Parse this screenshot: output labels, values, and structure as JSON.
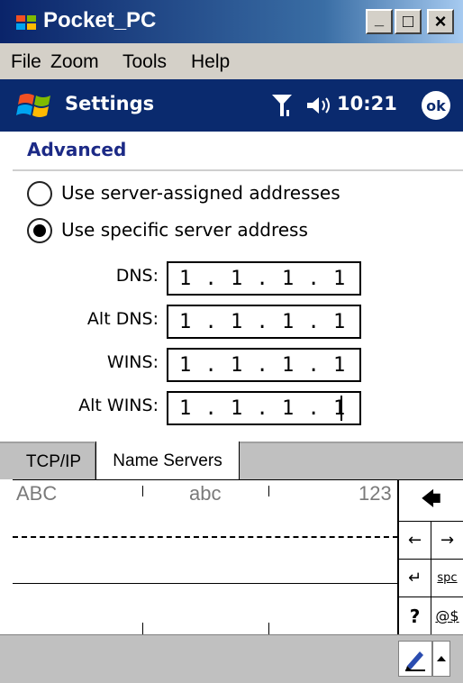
{
  "window": {
    "title": "Pocket_PC",
    "minimize_label": "_",
    "maximize_label": "□",
    "close_label": "×"
  },
  "menu": {
    "items": [
      {
        "label": "File"
      },
      {
        "label": "Zoom"
      },
      {
        "label": "Tools"
      },
      {
        "label": "Help"
      }
    ]
  },
  "navbar": {
    "title": "Settings",
    "clock": "10:21",
    "ok_label": "ok",
    "icons": [
      "start-flag-icon",
      "signal-icon",
      "volume-icon"
    ]
  },
  "content": {
    "heading": "Advanced",
    "radios": [
      {
        "label": "Use server-assigned addresses",
        "checked": false
      },
      {
        "label": "Use specific server address",
        "checked": true
      }
    ],
    "fields": [
      {
        "label": "DNS:",
        "value": "1 . 1 . 1 . 1"
      },
      {
        "label": "Alt DNS:",
        "value": "1 . 1 . 1 . 1"
      },
      {
        "label": "WINS:",
        "value": "1 . 1 . 1 . 1"
      },
      {
        "label": "Alt WINS:",
        "value": "1 . 1 . 1 . 1"
      }
    ]
  },
  "tabs": [
    {
      "label": "TCP/IP",
      "active": false
    },
    {
      "label": "Name Servers",
      "active": true
    }
  ],
  "input_panel": {
    "hints": [
      "ABC",
      "abc",
      "123"
    ],
    "keys": {
      "backspace": "🡄",
      "left": "←",
      "right": "→",
      "enter": "↵",
      "space": "spc",
      "help": "?",
      "symbols": "@$"
    }
  },
  "colors": {
    "titlebar": "#0a246a",
    "navbar": "#0a2a6e",
    "heading": "#1c2a86",
    "chrome": "#d4d0c8"
  }
}
